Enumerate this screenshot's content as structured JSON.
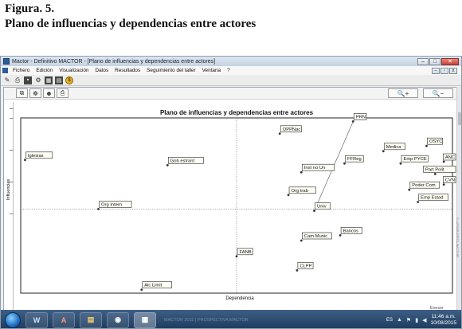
{
  "caption": {
    "figure_number": "Figura. 5.",
    "title": "Plano de influencias y dependencias entre actores"
  },
  "window": {
    "title": "Mactor - Definitivo MACTOR - [Plano de influencias y dependencias entre actores]",
    "controls": {
      "minimize": "–",
      "maximize": "□",
      "close": "✕"
    },
    "mdi_controls": {
      "minimize": "–",
      "restore": "▫",
      "close": "x"
    }
  },
  "menu": {
    "items": [
      "Fichero",
      "Edición",
      "Visualización",
      "Datos",
      "Resultados",
      "Seguimiento del taller",
      "Ventana",
      "?"
    ]
  },
  "toolbar": {
    "icons": [
      "pencil-icon",
      "printer-icon",
      "save-icon",
      "chart-icon",
      "grid-icon",
      "table-icon",
      "coin-icon"
    ]
  },
  "chart_toolbar": {
    "icons": [
      "copy-icon",
      "actors-icon",
      "people-icon",
      "print-icon"
    ],
    "zoom_in": "🔍+",
    "zoom_out": "🔍−"
  },
  "chart_data": {
    "type": "scatter",
    "title": "Plano de influencias y dependencias entre actores",
    "xlabel": "Dependencia",
    "ylabel": "Influencias",
    "right_watermark": "© LIPSOR-EPITA-MACTOR",
    "xlim": [
      0,
      100
    ],
    "ylim": [
      0,
      100
    ],
    "center": [
      50,
      48
    ],
    "points": [
      {
        "label": "Iglesias",
        "x": 1,
        "y": 76
      },
      {
        "label": "Gob estrant",
        "x": 34,
        "y": 73
      },
      {
        "label": "OPPNac",
        "x": 60,
        "y": 91
      },
      {
        "label": "PRN",
        "x": 77,
        "y": 98
      },
      {
        "label": "Medica",
        "x": 84,
        "y": 81
      },
      {
        "label": "OSYC",
        "x": 94,
        "y": 84
      },
      {
        "label": "ANC",
        "x": 98,
        "y": 75
      },
      {
        "label": "FFReg",
        "x": 75,
        "y": 74
      },
      {
        "label": "Emp PYCE",
        "x": 88,
        "y": 74
      },
      {
        "label": "Part Polit",
        "x": 96,
        "y": 68
      },
      {
        "label": "Inst no Un",
        "x": 65,
        "y": 69
      },
      {
        "label": "CVN",
        "x": 98,
        "y": 62
      },
      {
        "label": "Poder Com",
        "x": 90,
        "y": 59
      },
      {
        "label": "Org trab",
        "x": 62,
        "y": 56
      },
      {
        "label": "Emp Estad",
        "x": 92,
        "y": 52
      },
      {
        "label": "Org Intern",
        "x": 18,
        "y": 48
      },
      {
        "label": "Univ",
        "x": 68,
        "y": 47
      },
      {
        "label": "Bancos",
        "x": 74,
        "y": 33
      },
      {
        "label": "Cam Munic",
        "x": 65,
        "y": 30
      },
      {
        "label": "FANB",
        "x": 50,
        "y": 21
      },
      {
        "label": "CLPP",
        "x": 64,
        "y": 13
      },
      {
        "label": "Alc Limit",
        "x": 28,
        "y": 2
      }
    ]
  },
  "taskbar": {
    "apps": [
      {
        "name": "word",
        "glyph": "W"
      },
      {
        "name": "pdf",
        "glyph": "A"
      },
      {
        "name": "folder",
        "glyph": "▤"
      },
      {
        "name": "chrome",
        "glyph": "◉"
      },
      {
        "name": "mactor",
        "glyph": "▦"
      }
    ],
    "ghost_text": "MACTOR 2015 | PROSPECTIVA MACTOR",
    "language": "ES",
    "time": "11:46 a.m.",
    "date": "10/08/2015",
    "status_label": "Exeser"
  }
}
